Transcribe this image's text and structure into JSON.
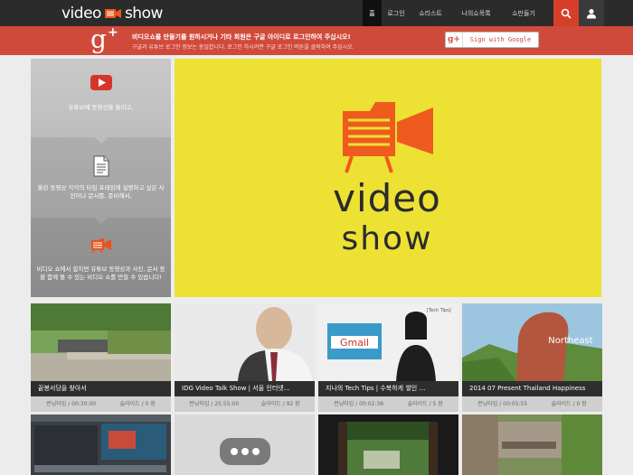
{
  "brand": {
    "part1": "video",
    "part2": "show"
  },
  "nav": {
    "items": [
      {
        "label": "홈",
        "active": true
      },
      {
        "label": "로그인",
        "active": false
      },
      {
        "label": "쇼리스트",
        "active": false
      },
      {
        "label": "나의쇼목록",
        "active": false
      },
      {
        "label": "쇼만들기",
        "active": false
      }
    ],
    "search_icon": "search-icon",
    "user_icon": "user-icon"
  },
  "banner": {
    "line1": "비디오쇼를 만들기를 원하시거나 기타 회원은 구글 아이디로 로그인하여 주십시오!",
    "line2": "구글과 유튜브 로그인 정보는 동일합니다. 로그인 하시려면 구글 로그인 버튼을 클릭하여 주십시오.",
    "signin_label": "Sign with Google",
    "accent": "#d04a3b"
  },
  "steps": [
    {
      "icon": "youtube-icon",
      "text": "유튜브에 동영상을 올리고,"
    },
    {
      "icon": "document-icon",
      "text": "올린 동영상 각각의 타임 프레임에 설명하고 싶은 사진이나 문서를, 준비해서,"
    },
    {
      "icon": "videoshow-icon",
      "text": "비디오 쇼에서 합치면 유튜브 동영상과 사진, 문서 등을 함께 볼 수 있는 비디오 쇼를 만들 수 있습니다!"
    }
  ],
  "hero": {
    "line1": "video",
    "line2": "show",
    "bg": "#ede134"
  },
  "cards": [
    {
      "title": "끝봉서당을 찾아서",
      "runtime": "런닝타임 / 00:30:00",
      "slides": "슬라이드 / 0 장"
    },
    {
      "title": "IDG Video Talk Show | 서울 인터넷…",
      "runtime": "런닝타임 / 25:55:00",
      "slides": "슬라이드 / 92 장"
    },
    {
      "title": "지나의 Tech Tips | 수북하게 쌓인 …",
      "runtime": "런닝타임 / 00:02:36",
      "slides": "슬라이드 / 5 장"
    },
    {
      "title": "2014 07 Present Thailand Happiness",
      "runtime": "런닝타임 / 00:05:55",
      "slides": "슬라이드 / 0 장"
    }
  ],
  "thumb_labels": {
    "gmail": "Gmail",
    "northeast": "Northeast",
    "tech_tips": "[Tech Tips]"
  }
}
